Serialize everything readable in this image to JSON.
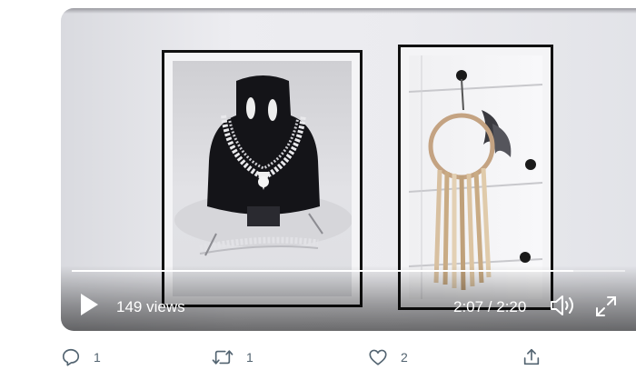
{
  "video": {
    "views": "149 views",
    "time": "2:07 / 2:20",
    "progress": 0.907
  },
  "actions": {
    "reply_count": "1",
    "retweet_count": "1",
    "like_count": "2"
  },
  "icons": {
    "play": "play-icon",
    "volume": "volume-icon",
    "fullscreen": "fullscreen-icon",
    "reply": "reply-icon",
    "retweet": "retweet-icon",
    "like": "heart-icon",
    "share": "share-icon"
  },
  "colors": {
    "action_icon": "#536471",
    "frame_border": "#111111"
  }
}
